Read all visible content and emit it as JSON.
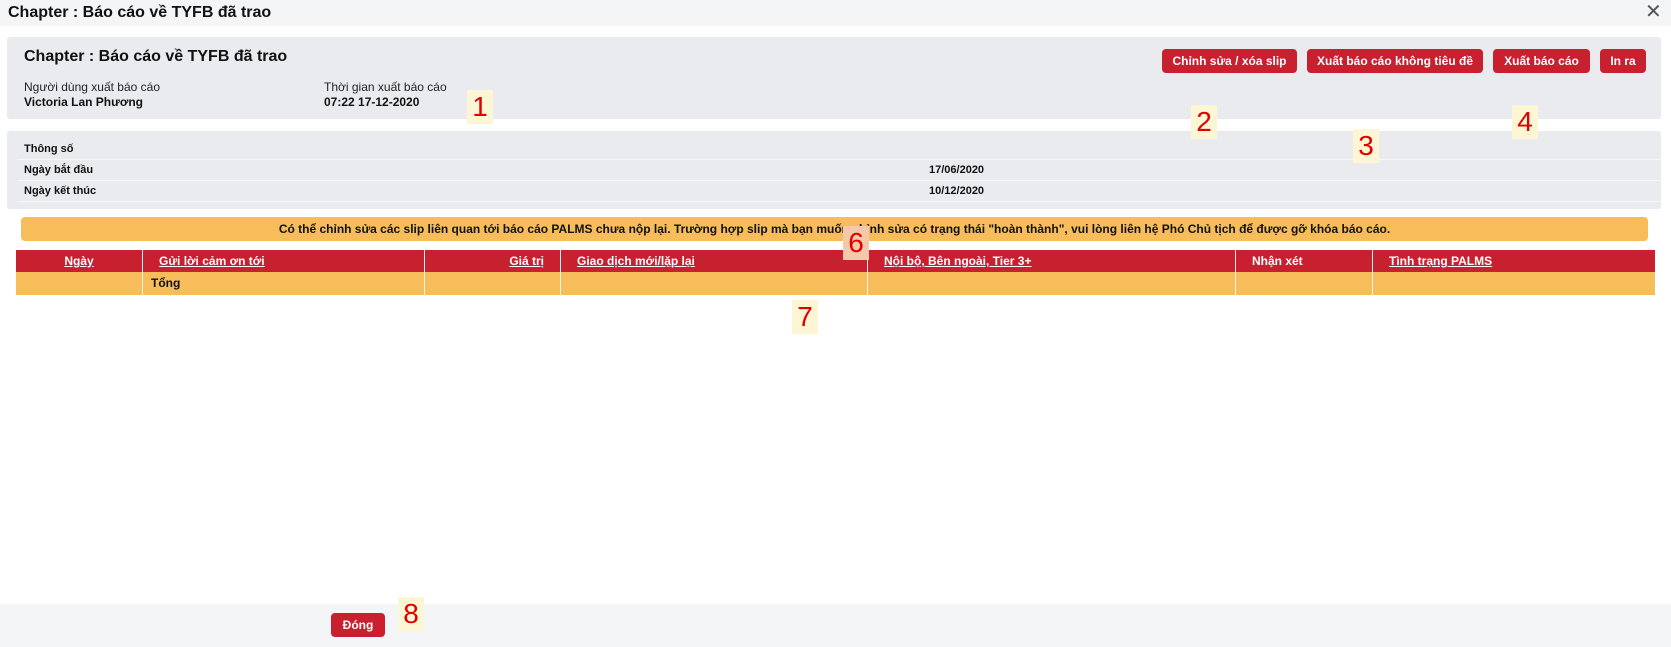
{
  "window": {
    "title": "Chapter : Báo cáo về TYFB đã trao"
  },
  "header": {
    "title": "Chapter : Báo cáo về TYFB đã trao",
    "user_label": "Người dùng xuất báo cáo",
    "user_value": "Victoria Lan Phương",
    "time_label": "Thời gian xuất báo cáo",
    "time_value": "07:22 17-12-2020",
    "buttons": {
      "edit": "Chỉnh sửa / xóa slip",
      "export_no_title": "Xuất báo cáo không tiêu đề",
      "export": "Xuất báo cáo",
      "print": "In ra"
    }
  },
  "params": {
    "heading": "Thông số",
    "rows": [
      {
        "label": "Ngày bắt đầu",
        "value": "17/06/2020"
      },
      {
        "label": "Ngày kết thúc",
        "value": "10/12/2020"
      }
    ]
  },
  "notice": "Có thể chỉnh sửa các slip liên quan tới báo cáo PALMS chưa nộp lại. Trường hợp slip mà bạn muốn chỉnh sửa có trạng thái \"hoàn thành\", vui lòng liên hệ Phó Chủ tịch để được gỡ khóa báo cáo.",
  "table": {
    "columns": [
      "Ngày",
      "Gửi lời cảm ơn tới",
      "Giá trị",
      "Giao dịch mới/lặp lại",
      "Nội bộ, Bên ngoài, Tier 3+",
      "Nhận xét",
      "Tình trạng PALMS"
    ],
    "total_label": "Tổng"
  },
  "footer": {
    "close_label": "Đóng"
  },
  "markers": [
    "1",
    "2",
    "3",
    "4",
    "6",
    "7",
    "8"
  ],
  "colors": {
    "accent": "#c8202f",
    "highlight": "#f6bd5a",
    "panel": "#e9ebef",
    "marker": "#e00000"
  },
  "icons": {
    "close": "close-icon"
  }
}
